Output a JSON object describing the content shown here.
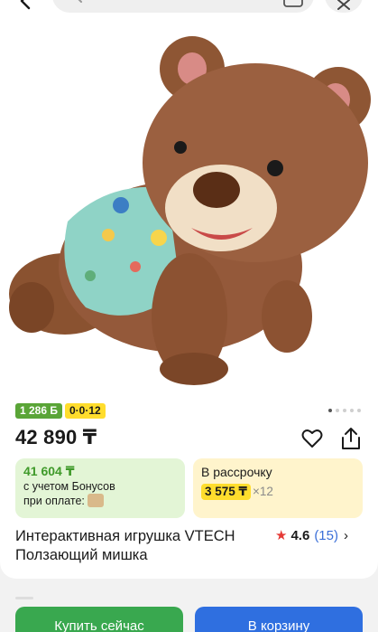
{
  "top_bar": {
    "back_icon": "chevron-left-icon",
    "search_icon": "search-icon",
    "camera_icon": "camera-icon",
    "more_icon": "more-icon"
  },
  "product": {
    "image_subject": "plush-bear-toy",
    "badges": {
      "bonus": "1 286 Б",
      "installment": "0·0·12"
    },
    "price": "42 890 ₸",
    "bonus_box": {
      "amount": "41 604 ₸",
      "line1": "с учетом Бонусов",
      "line2": "при оплате:"
    },
    "installment_box": {
      "title": "В рассрочку",
      "monthly": "3 575 ₸",
      "months": "×12"
    },
    "title": "Интерактивная игрушка VTECH Ползающий мишка",
    "rating": {
      "value": "4.6",
      "count": "(15)"
    }
  },
  "actions": {
    "buy_now": "Купить сейчас",
    "add_to_cart": "В корзину"
  },
  "colors": {
    "bonus_green": "#5aa537",
    "installment_yellow": "#ffdd2d",
    "buy_button": "#39a84f",
    "cart_button": "#2f6fe0",
    "rating_star": "#e53935",
    "link_blue": "#3a6fd8"
  }
}
